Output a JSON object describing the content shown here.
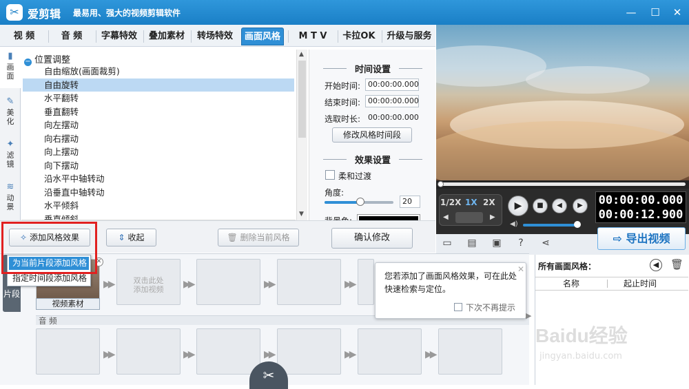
{
  "app": {
    "title": "爱剪辑",
    "slogan": "最易用、强大的视频剪辑软件",
    "logo": "scissors-logo"
  },
  "window": {
    "minimize": "—",
    "maximize": "☐",
    "close": "✕"
  },
  "tabs": [
    {
      "label": "视 频"
    },
    {
      "label": "音 频"
    },
    {
      "label": "字幕特效"
    },
    {
      "label": "叠加素材"
    },
    {
      "label": "转场特效"
    },
    {
      "label": "画面风格",
      "active": true
    },
    {
      "label": "M T V"
    },
    {
      "label": "卡拉OK"
    },
    {
      "label": "升级与服务"
    }
  ],
  "left_nav": [
    {
      "label": "画面",
      "icon": "screen-icon",
      "active": true
    },
    {
      "label": "美化",
      "icon": "magic-wand-icon"
    },
    {
      "label": "滤镜",
      "icon": "filter-wand-icon"
    },
    {
      "label": "动景",
      "icon": "wave-icon"
    }
  ],
  "list": {
    "header": "位置调整",
    "items": [
      "自由缩放(画面裁剪)",
      "自由旋转",
      "水平翻转",
      "垂直翻转",
      "向左摆动",
      "向右摆动",
      "向上摆动",
      "向下摆动",
      "沿水平中轴转动",
      "沿垂直中轴转动",
      "水平倾斜",
      "垂直倾斜"
    ],
    "selected_index": 1
  },
  "settings": {
    "time_section": "时间设置",
    "start_label": "开始时间:",
    "start_value": "00:00:00.000",
    "end_label": "结束时间:",
    "end_value": "00:00:00.000",
    "duration_label": "选取时长:",
    "duration_value": "00:00:00.000",
    "modify_time_button": "修改风格时间段",
    "effect_section": "效果设置",
    "fade_label": "柔和过渡",
    "angle_label": "角度:",
    "angle_value": "20",
    "bg_color_label": "背景色:",
    "confirm_button": "确认修改"
  },
  "toolbar": {
    "add_effect": "添加风格效果",
    "collapse": "收起",
    "delete": "删除当前风格"
  },
  "menu": {
    "items": [
      "为当前片段添加风格",
      "指定时间段添加风格"
    ],
    "highlighted_index": 0
  },
  "player": {
    "speeds": [
      "1/2X",
      "1X",
      "2X"
    ],
    "active_speed": "1X",
    "time_current": "00:00:00.000",
    "time_total": "00:00:12.900",
    "export_label": "导出视频"
  },
  "timeline": {
    "video_clip_label": "视频素材",
    "add_video_hint": "双击此处\n添加视频",
    "audio_label": "音 频",
    "side_tab_label": "已添加片段",
    "side_tab_visible": "片段"
  },
  "tip": {
    "text": "您若添加了画面风格效果，可在此处快速检索与定位。",
    "dont_show": "下次不再提示"
  },
  "right_panel": {
    "title": "所有画面风格：",
    "col_name": "名称",
    "col_start": "起止时间"
  },
  "watermark": {
    "brand": "Baidu经验",
    "url": "jingyan.baidu.com"
  }
}
